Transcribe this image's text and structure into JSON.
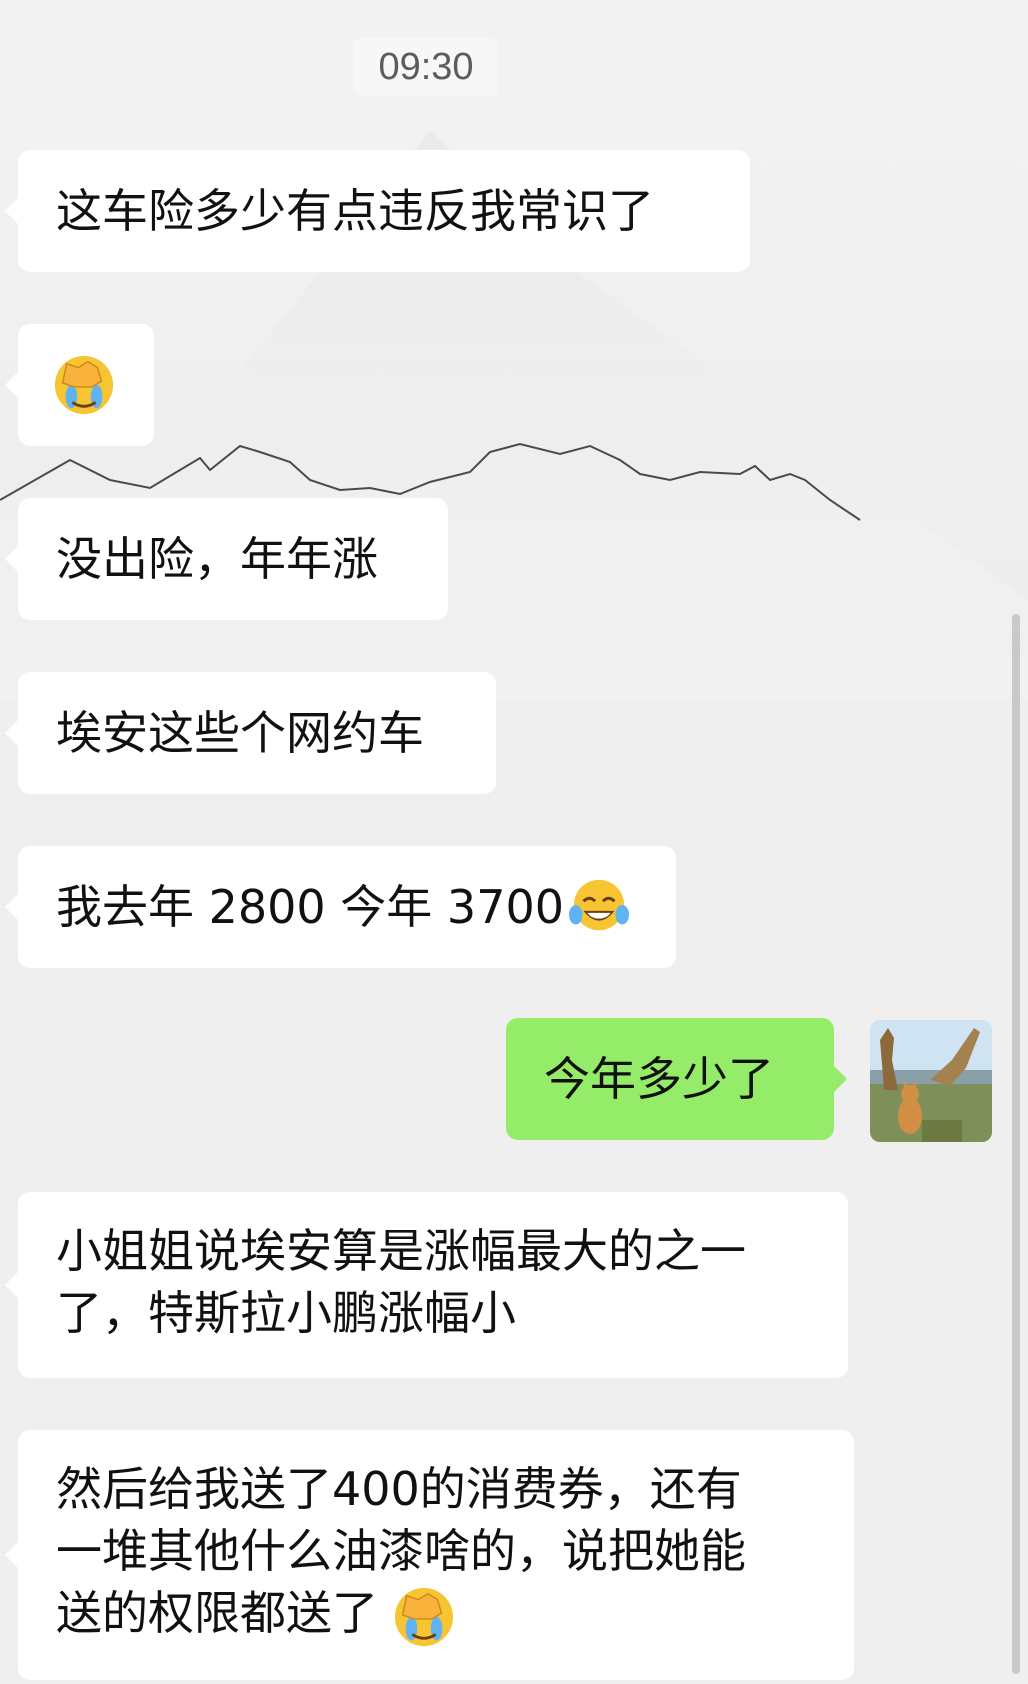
{
  "timestamp": "09:30",
  "messages": {
    "m1": "这车险多少有点违反我常识了",
    "m3": "没出险，年年涨",
    "m4": "埃安这些个网约车",
    "m5": "我去年 2800 今年 3700",
    "m6": "今年多少了",
    "m7_line1": "小姐姐说埃安算是涨幅最大的之一",
    "m7_line2": "了，特斯拉小鹏涨幅小",
    "m8_line1": "然后给我送了400的消费券，还有",
    "m8_line2": "一堆其他什么油漆啥的，说把她能",
    "m8_line3": "送的权限都送了"
  },
  "emojis": {
    "m2": "face-palm-emoji",
    "m5": "tears-of-joy-emoji",
    "m8": "face-palm-emoji"
  },
  "colors": {
    "chat_background": "#efefef",
    "incoming_bubble": "#ffffff",
    "outgoing_bubble": "#95ec69"
  }
}
